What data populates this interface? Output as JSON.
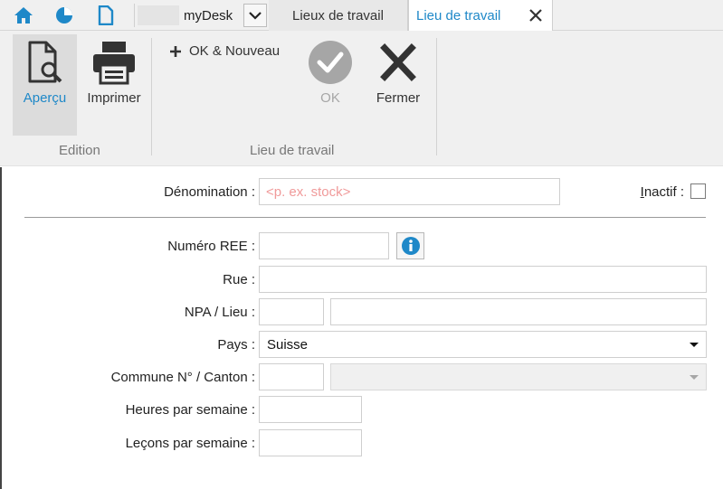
{
  "tabbar": {
    "icons": [
      "home-icon",
      "chart-pie-icon",
      "document-icon"
    ],
    "desk_label": "myDesk",
    "tabs": [
      {
        "label": "Lieux de travail",
        "active": false
      },
      {
        "label": "Lieu de travail",
        "active": true
      }
    ]
  },
  "ribbon": {
    "edition_group": {
      "label": "Edition",
      "apercu_label": "Aperçu",
      "imprimer_label": "Imprimer"
    },
    "lieu_group": {
      "label": "Lieu de travail",
      "ok_nouveau_label": "OK & Nouveau",
      "ok_label": "OK",
      "fermer_label": "Fermer"
    }
  },
  "form": {
    "denomination": {
      "label": "Dénomination :",
      "value": "",
      "placeholder": "<p. ex. stock>"
    },
    "inactif": {
      "label": "Inactif :",
      "checked": false
    },
    "numero_ree": {
      "label": "Numéro REE :",
      "value": ""
    },
    "rue": {
      "label": "Rue :",
      "value": ""
    },
    "npa_lieu": {
      "label": "NPA / Lieu :",
      "npa": "",
      "lieu": ""
    },
    "pays": {
      "label": "Pays :",
      "value": "Suisse"
    },
    "commune_canton": {
      "label": "Commune N° / Canton :",
      "commune": "",
      "canton": ""
    },
    "heures": {
      "label": "Heures par semaine :",
      "value": ""
    },
    "lecons": {
      "label": "Leçons par semaine :",
      "value": ""
    }
  },
  "colors": {
    "accent": "#1e88c8",
    "placeholder": "#f09a9a",
    "disabled": "#a6a6a6"
  }
}
